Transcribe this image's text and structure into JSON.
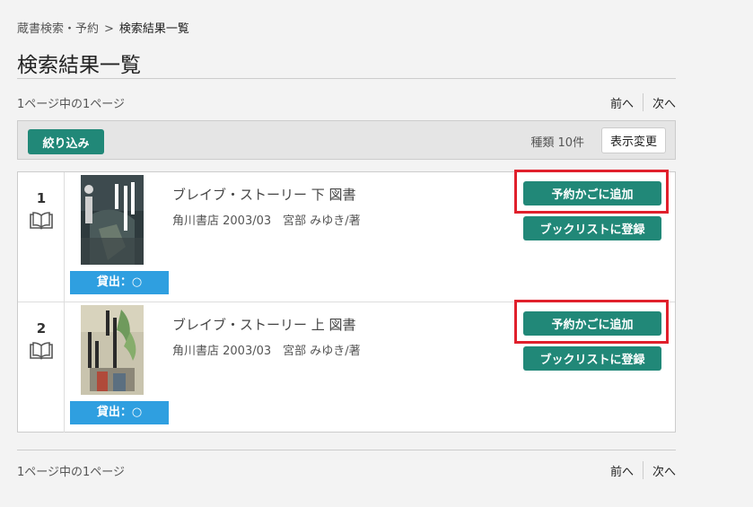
{
  "breadcrumb": {
    "parent": "蔵書検索・予約",
    "separator": ">",
    "current": "検索結果一覧"
  },
  "page_title": "検索結果一覧",
  "pager_top": {
    "info": "1ページ中の1ページ",
    "prev": "前へ",
    "next": "次へ"
  },
  "pager_bottom": {
    "info": "1ページ中の1ページ",
    "prev": "前へ",
    "next": "次へ"
  },
  "filterbar": {
    "filter_label": "絞り込み",
    "kinds_label": "種類 10件",
    "view_change_label": "表示変更"
  },
  "results": [
    {
      "number": "1",
      "title": "ブレイブ・ストーリー 下 図書",
      "publication": "角川書店 2003/03　宮部 みゆき∕著",
      "availability": "貸出：○",
      "reserve_label": "予約かごに追加",
      "booklist_label": "ブックリストに登録"
    },
    {
      "number": "2",
      "title": "ブレイブ・ストーリー 上 図書",
      "publication": "角川書店 2003/03　宮部 みゆき∕著",
      "availability": "貸出：○",
      "reserve_label": "予約かごに追加",
      "booklist_label": "ブックリストに登録"
    }
  ],
  "colors": {
    "accent": "#218878",
    "available": "#2f9fe0",
    "highlight": "#e0202c"
  },
  "icons": {
    "item_type": "book-icon"
  }
}
